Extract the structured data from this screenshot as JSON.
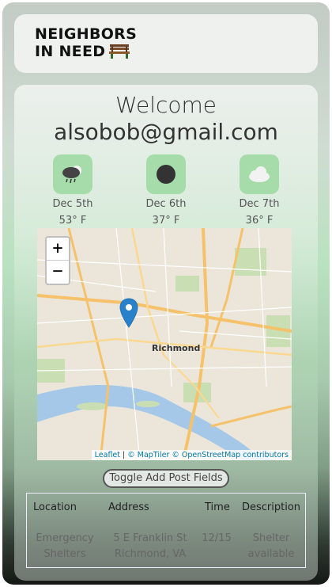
{
  "header": {
    "logo_line1": "NEIGHBORS",
    "logo_line2": "IN NEED"
  },
  "welcome": {
    "greeting": "Welcome",
    "email": "alsobob@gmail.com"
  },
  "weather": [
    {
      "date": "Dec 5th",
      "temp": "53° F",
      "icon": "rain-cloud-icon"
    },
    {
      "date": "Dec 6th",
      "temp": "37° F",
      "icon": "dark-circle-icon"
    },
    {
      "date": "Dec 7th",
      "temp": "36° F",
      "icon": "cloud-icon"
    }
  ],
  "map": {
    "zoom_in": "+",
    "zoom_out": "−",
    "city": "Richmond",
    "attribution_leaflet": "Leaflet",
    "attribution_rest": "© MapTiler © OpenStreetMap contributors"
  },
  "toggle_button": "Toggle Add Post Fields",
  "table": {
    "headers": [
      "Location",
      "Address",
      "Time",
      "Description"
    ],
    "rows": [
      {
        "location_l1": "Emergency",
        "location_l2": "Shelters",
        "address_l1": "5 E Franklin St",
        "address_l2": "Richmond, VA",
        "time": "12/15",
        "desc_l1": "Shelter",
        "desc_l2": "available"
      }
    ]
  }
}
